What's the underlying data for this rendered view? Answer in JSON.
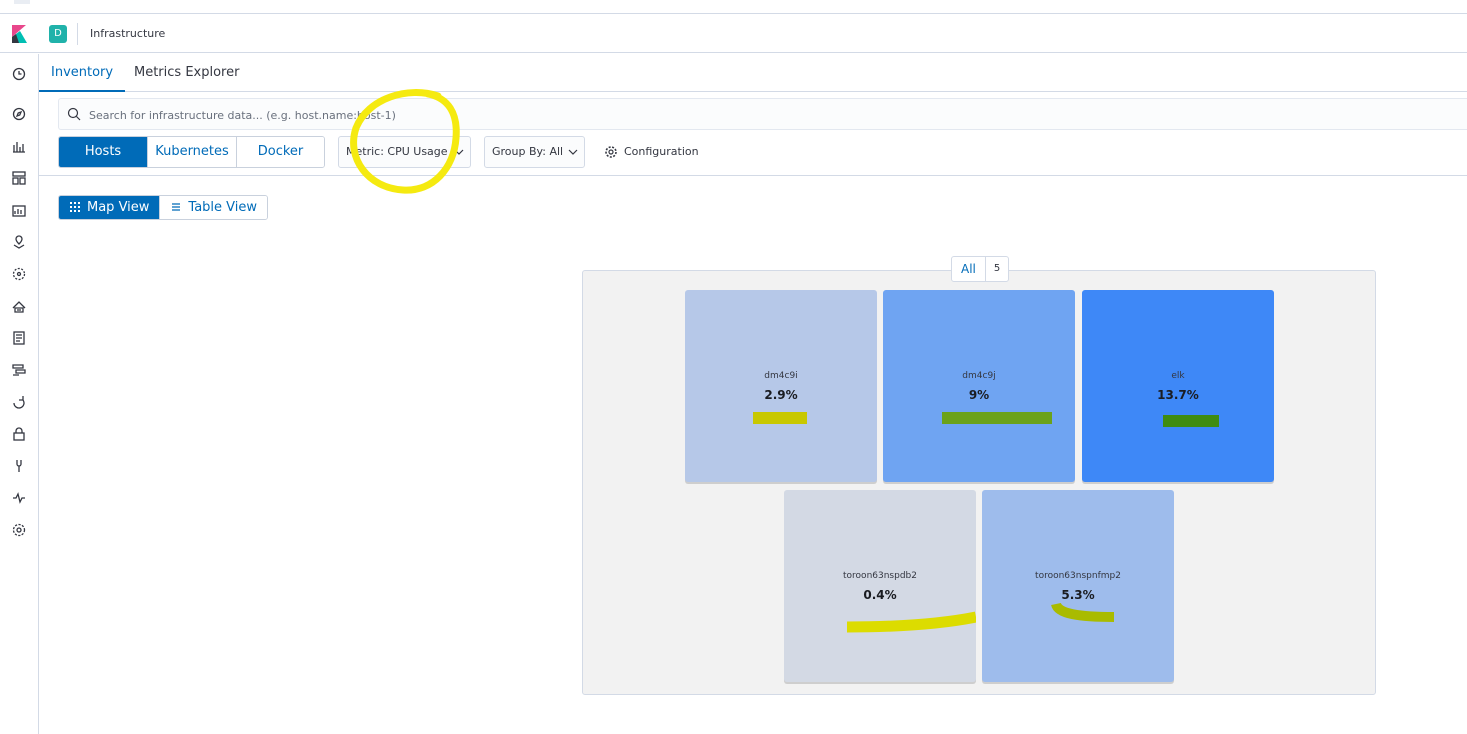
{
  "header": {
    "space_initial": "D",
    "title": "Infrastructure"
  },
  "tabs": [
    {
      "label": "Inventory",
      "active": true
    },
    {
      "label": "Metrics Explorer",
      "active": false
    }
  ],
  "search": {
    "placeholder": "Search for infrastructure data... (e.g. host.name:host-1)",
    "value": ""
  },
  "node_types": [
    {
      "label": "Hosts",
      "selected": true
    },
    {
      "label": "Kubernetes",
      "selected": false
    },
    {
      "label": "Docker",
      "selected": false
    }
  ],
  "metric_dropdown": {
    "label": "Metric: CPU Usage"
  },
  "groupby_dropdown": {
    "label": "Group By: All"
  },
  "configuration": {
    "label": "Configuration"
  },
  "views": [
    {
      "label": "Map View",
      "selected": true
    },
    {
      "label": "Table View",
      "selected": false
    }
  ],
  "map": {
    "group_name": "All",
    "group_count": "5",
    "nodes": [
      {
        "name": "dm4c9i",
        "value": "2.9%",
        "color": "#b6c8e8",
        "bar_color": "#c8c800"
      },
      {
        "name": "dm4c9j",
        "value": "9%",
        "color": "#6fa4f2",
        "bar_color": "#6ba21a"
      },
      {
        "name": "elk",
        "value": "13.7%",
        "color": "#3e88f7",
        "bar_color": "#3f8c10"
      },
      {
        "name": "toroon63nspdb2",
        "value": "0.4%",
        "color": "#d3d9e4",
        "bar_color": "#dcdc00"
      },
      {
        "name": "toroon63nspnfmp2",
        "value": "5.3%",
        "color": "#9ebcec",
        "bar_color": "#a9bb00"
      }
    ]
  },
  "colors": {
    "accent": "#006bb8",
    "highlight_annotation": "#f5ea10"
  }
}
